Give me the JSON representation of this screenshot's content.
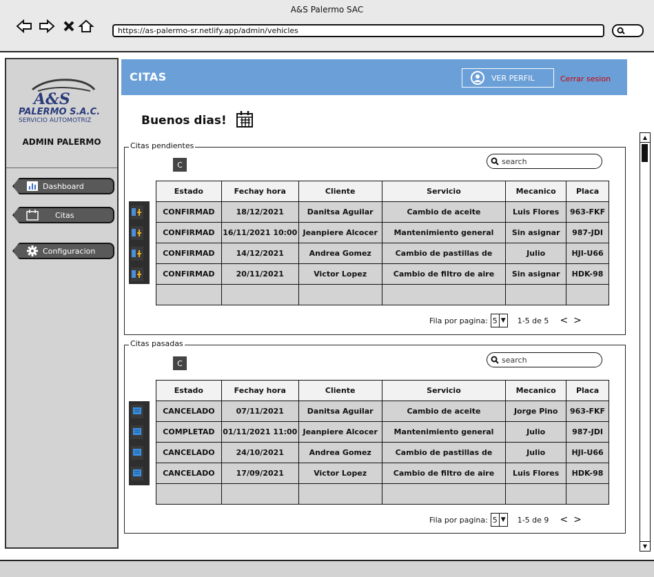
{
  "window": {
    "title": "A&S Palermo SAC",
    "url": "https://as-palermo-sr.netlify.app/admin/vehicles"
  },
  "sidebar": {
    "logo": {
      "line1": "A&S",
      "line2": "PALERMO S.A.C.",
      "line3": "SERVICIO AUTOMOTRIZ"
    },
    "admin_name": "ADMIN PALERMO",
    "items": [
      {
        "label": "Dashboard",
        "icon": "bar-chart-icon"
      },
      {
        "label": "Citas",
        "icon": "calendar-icon"
      },
      {
        "label": "Configuracion",
        "icon": "gear-icon"
      }
    ]
  },
  "header": {
    "title": "CITAS",
    "profile_label": "VER PERFIL",
    "logout_label": "Cerrar sesion",
    "accent": "#6a9fd8",
    "logout_color": "#cc0000"
  },
  "greeting": "Buenos dias!",
  "pending": {
    "legend": "Citas pendientes",
    "refresh_label": "C",
    "search_placeholder": "search",
    "columns": [
      "Estado",
      "Fechay hora",
      "Cliente",
      "Servicio",
      "Mecanico",
      "Placa"
    ],
    "rows": [
      [
        "CONFIRMAD",
        "18/12/2021",
        "Danitsa Aguilar",
        "Cambio de aceite",
        "Luis Flores",
        "963-FKF"
      ],
      [
        "CONFIRMAD",
        "16/11/2021 10:00",
        "Jeanpiere Alcocer",
        "Mantenimiento general",
        "Sin asignar",
        "987-JDI"
      ],
      [
        "CONFIRMAD",
        "14/12/2021",
        "Andrea Gomez",
        "Cambio de pastillas de",
        "Julio",
        "HJI-U66"
      ],
      [
        "CONFIRMAD",
        "20/11/2021",
        "Victor Lopez",
        "Cambio de filtro de aire",
        "Sin asignar",
        "HDK-98"
      ]
    ],
    "pager": {
      "label": "Fila por pagina:",
      "per_page": "5",
      "range": "1-5 de 5"
    }
  },
  "past": {
    "legend": "Citas pasadas",
    "refresh_label": "C",
    "search_placeholder": "search",
    "columns": [
      "Estado",
      "Fechay hora",
      "Cliente",
      "Servicio",
      "Mecanico",
      "Placa"
    ],
    "rows": [
      [
        "CANCELADO",
        "07/11/2021",
        "Danitsa Aguilar",
        "Cambio de aceite",
        "Jorge Pino",
        "963-FKF"
      ],
      [
        "COMPLETAD",
        "01/11/2021 11:00",
        "Jeanpiere Alcocer",
        "Mantenimiento general",
        "Julio",
        "987-JDI"
      ],
      [
        "CANCELADO",
        "24/10/2021",
        "Andrea Gomez",
        "Cambio de pastillas de",
        "Julio",
        "HJI-U66"
      ],
      [
        "CANCELADO",
        "17/09/2021",
        "Victor Lopez",
        "Cambio de filtro de aire",
        "Luis Flores",
        "HDK-98"
      ]
    ],
    "pager": {
      "label": "Fila por pagina:",
      "per_page": "5",
      "range": "1-5 de 9"
    }
  }
}
